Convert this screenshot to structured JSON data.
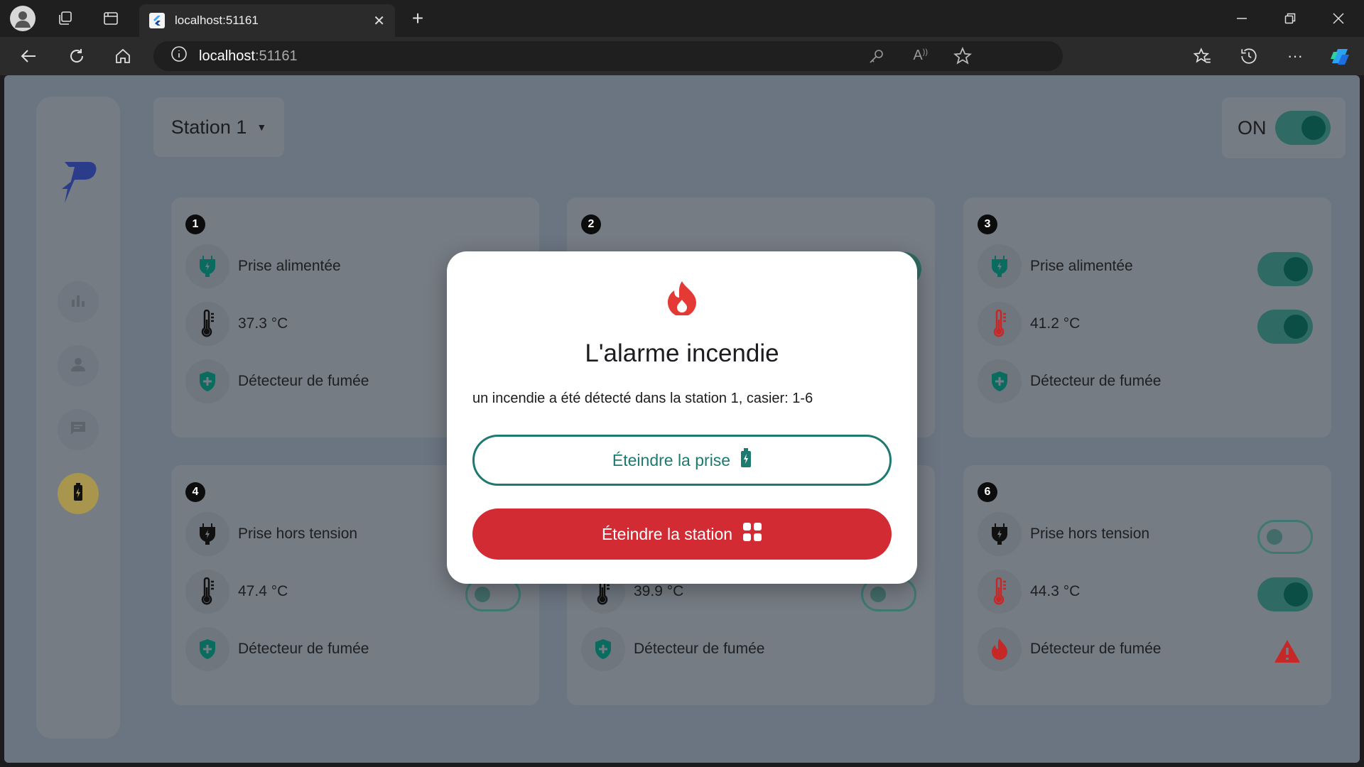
{
  "browser": {
    "tab_title": "localhost:51161",
    "address_host": "localhost",
    "address_port": ":51161"
  },
  "app": {
    "station_selector": "Station 1",
    "master_label": "ON",
    "master_on": true
  },
  "cards": [
    {
      "number": "1",
      "plug_label": "Prise alimentée",
      "plug_on": true,
      "temp": "37.3 °C",
      "temp_switch_on": false,
      "smoke_label": "Détecteur de fumée",
      "smoke_alert": false
    },
    {
      "number": "2",
      "plug_label": "",
      "plug_on": true,
      "temp": "",
      "temp_switch_on": false,
      "smoke_label": "",
      "smoke_alert": false
    },
    {
      "number": "3",
      "plug_label": "Prise alimentée",
      "plug_on": true,
      "temp": "41.2 °C",
      "temp_switch_on": true,
      "smoke_label": "Détecteur de fumée",
      "smoke_alert": false
    },
    {
      "number": "4",
      "plug_label": "Prise hors tension",
      "plug_on": false,
      "temp": "47.4 °C",
      "temp_switch_on": false,
      "smoke_label": "Détecteur de fumée",
      "smoke_alert": false
    },
    {
      "number": "",
      "plug_label": "",
      "plug_on": false,
      "temp": "39.9 °C",
      "temp_switch_on": false,
      "smoke_label": "Détecteur de fumée",
      "smoke_alert": false
    },
    {
      "number": "6",
      "plug_label": "Prise hors tension",
      "plug_on": false,
      "temp": "44.3 °C",
      "temp_switch_on": true,
      "smoke_label": "Détecteur de fumée",
      "smoke_alert": true
    }
  ],
  "dialog": {
    "title": "L'alarme incendie",
    "message": "un incendie a été détecté dans la station 1, casier: 1-6",
    "button_plug": "Éteindre la prise",
    "button_station": "Éteindre la station"
  },
  "colors": {
    "accent": "#1d7a70",
    "danger": "#d22b34",
    "switch_on": "#0b4e46",
    "sidebar_active": "#a8964f"
  }
}
